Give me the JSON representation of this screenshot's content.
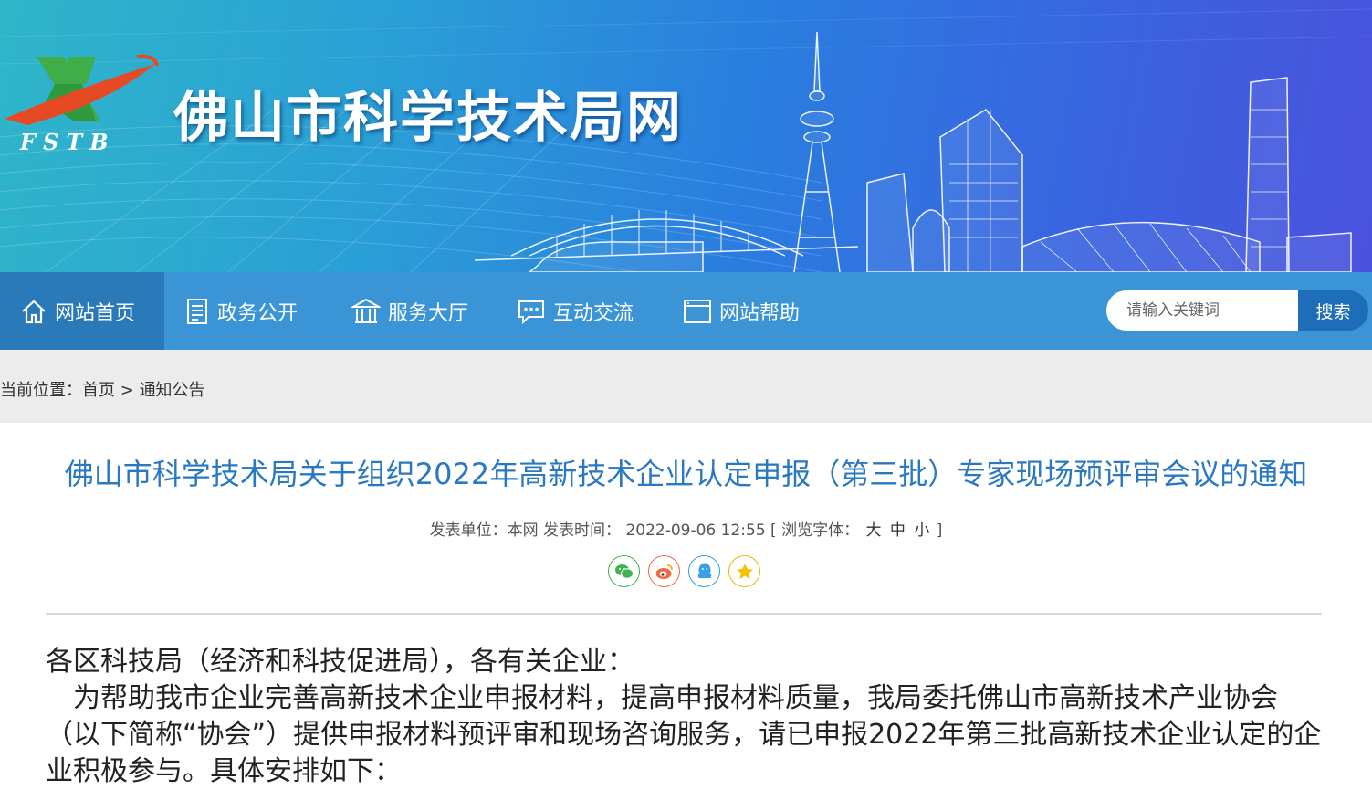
{
  "header": {
    "site_title": "佛山市科学技术局网",
    "logo_text": "FSTB"
  },
  "nav": {
    "items": [
      {
        "label": "网站首页",
        "icon": "home-icon",
        "active": true
      },
      {
        "label": "政务公开",
        "icon": "document-icon",
        "active": false
      },
      {
        "label": "服务大厅",
        "icon": "building-icon",
        "active": false
      },
      {
        "label": "互动交流",
        "icon": "chat-icon",
        "active": false
      },
      {
        "label": "网站帮助",
        "icon": "window-icon",
        "active": false
      }
    ],
    "search_placeholder": "请输入关键词",
    "search_button": "搜索"
  },
  "breadcrumb": {
    "prefix": "当前位置：",
    "home": "首页",
    "separator": ">",
    "current": "通知公告"
  },
  "article": {
    "title": "佛山市科学技术局关于组织2022年高新技术企业认定申报（第三批）专家现场预评审会议的通知",
    "meta_unit_label": "发表单位：",
    "meta_unit": "本网",
    "meta_time_label": "发表时间：",
    "meta_time": "2022-09-06 12:55",
    "meta_font_label": "[ 浏览字体：",
    "font_large": "大",
    "font_medium": "中",
    "font_small": "小",
    "meta_font_close": "]",
    "share_icons": [
      "wechat-icon",
      "weibo-icon",
      "qq-icon",
      "qzone-icon"
    ],
    "paragraphs": [
      "各区科技局（经济和科技促进局），各有关企业：",
      "　为帮助我市企业完善高新技术企业申报材料，提高申报材料质量，我局委托佛山市高新技术产业协会（以下简称“协会”）提供申报材料预评审和现场咨询服务，请已申报2022年第三批高新技术企业认定的企业积极参与。具体安排如下："
    ]
  },
  "colors": {
    "nav_bg": "#3a94d5",
    "nav_active": "#2a79b8",
    "title_color": "#2a78c2",
    "search_button": "#1d6db8"
  }
}
